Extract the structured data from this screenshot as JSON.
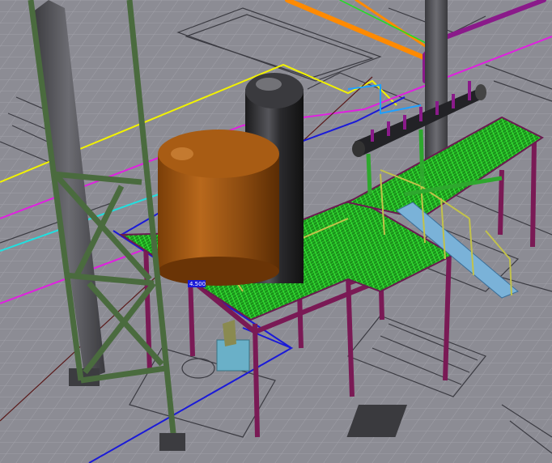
{
  "scene": {
    "colors": {
      "background": "#8c8c94",
      "grid": "#a3a3ab",
      "linework": "#3b3b42",
      "tank_brown": "#9a5212",
      "vessel_dark": "#2a2a2d",
      "steel_magenta": "#7a1a55",
      "grating_green": "#22b022",
      "column_green": "#4a6b3e",
      "pipe_orange": "#ff8a00",
      "pipe_purple": "#8a1a8a",
      "line_yellow": "#f2f200",
      "line_cyan": "#20e0e0",
      "line_magenta": "#e020e0",
      "line_blue": "#1a1ad8",
      "line_darkred": "#5a1a1a"
    },
    "labels": {
      "dimension_tag": "4.500"
    }
  }
}
